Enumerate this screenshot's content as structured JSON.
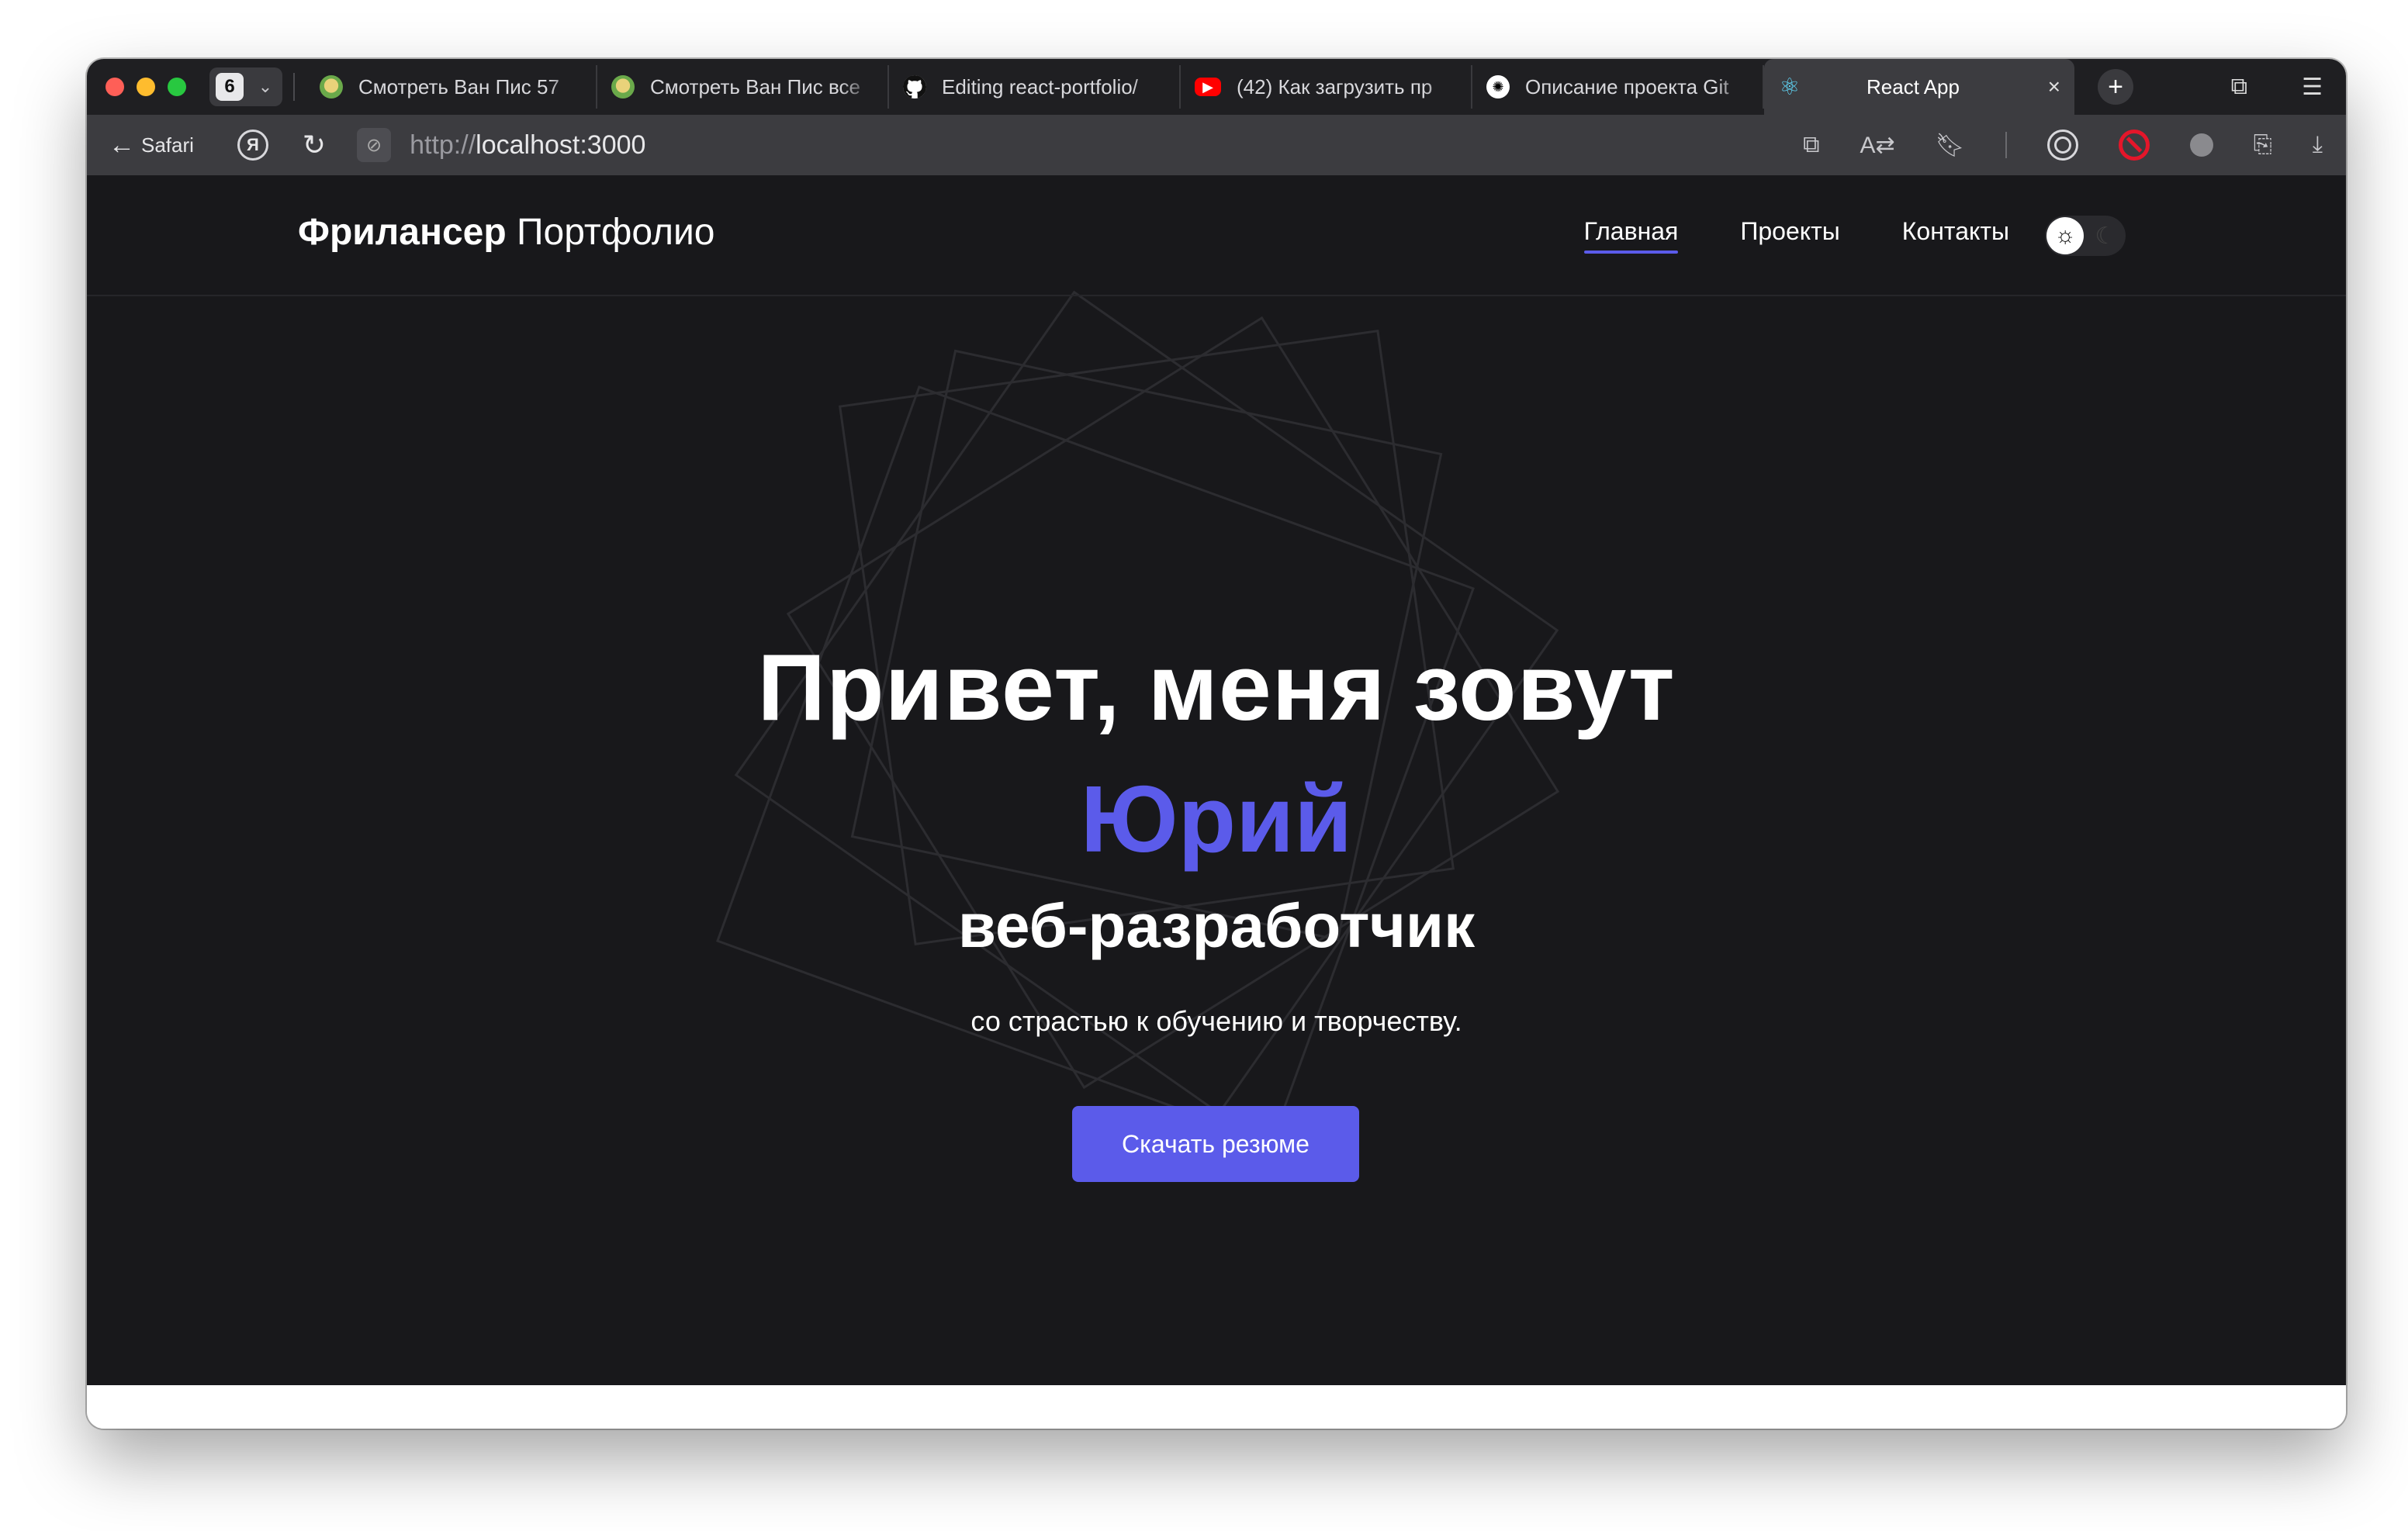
{
  "browser": {
    "tab_count": "6",
    "tabs": [
      {
        "label": "Смотреть Ван Пис 57",
        "icon": "one-piece-favicon"
      },
      {
        "label": "Смотреть Ван Пис все",
        "icon": "one-piece-favicon"
      },
      {
        "label": "Editing react-portfolio/",
        "icon": "github-icon"
      },
      {
        "label": "(42) Как загрузить пр",
        "icon": "youtube-icon"
      },
      {
        "label": "Описание проекта Git",
        "icon": "chatgpt-icon"
      },
      {
        "label": "React App",
        "icon": "react-icon",
        "active": true
      }
    ],
    "back_label": "Safari",
    "url_scheme": "http://",
    "url_host": "localhost:3000"
  },
  "site": {
    "brand_bold": "Фрилансер",
    "brand_regular": "Портфолио",
    "nav": [
      {
        "label": "Главная",
        "active": true
      },
      {
        "label": "Проекты"
      },
      {
        "label": "Контакты"
      }
    ],
    "theme": "dark"
  },
  "hero": {
    "greeting": "Привет, меня зовут",
    "name": "Юрий",
    "role": "веб-разработчик",
    "tagline": "со страстью к обучению и творчеству.",
    "cta_label": "Скачать резюме"
  },
  "colors": {
    "accent": "#5b5bea",
    "page_bg": "#18181b",
    "chrome_bg": "#1f1f22"
  }
}
